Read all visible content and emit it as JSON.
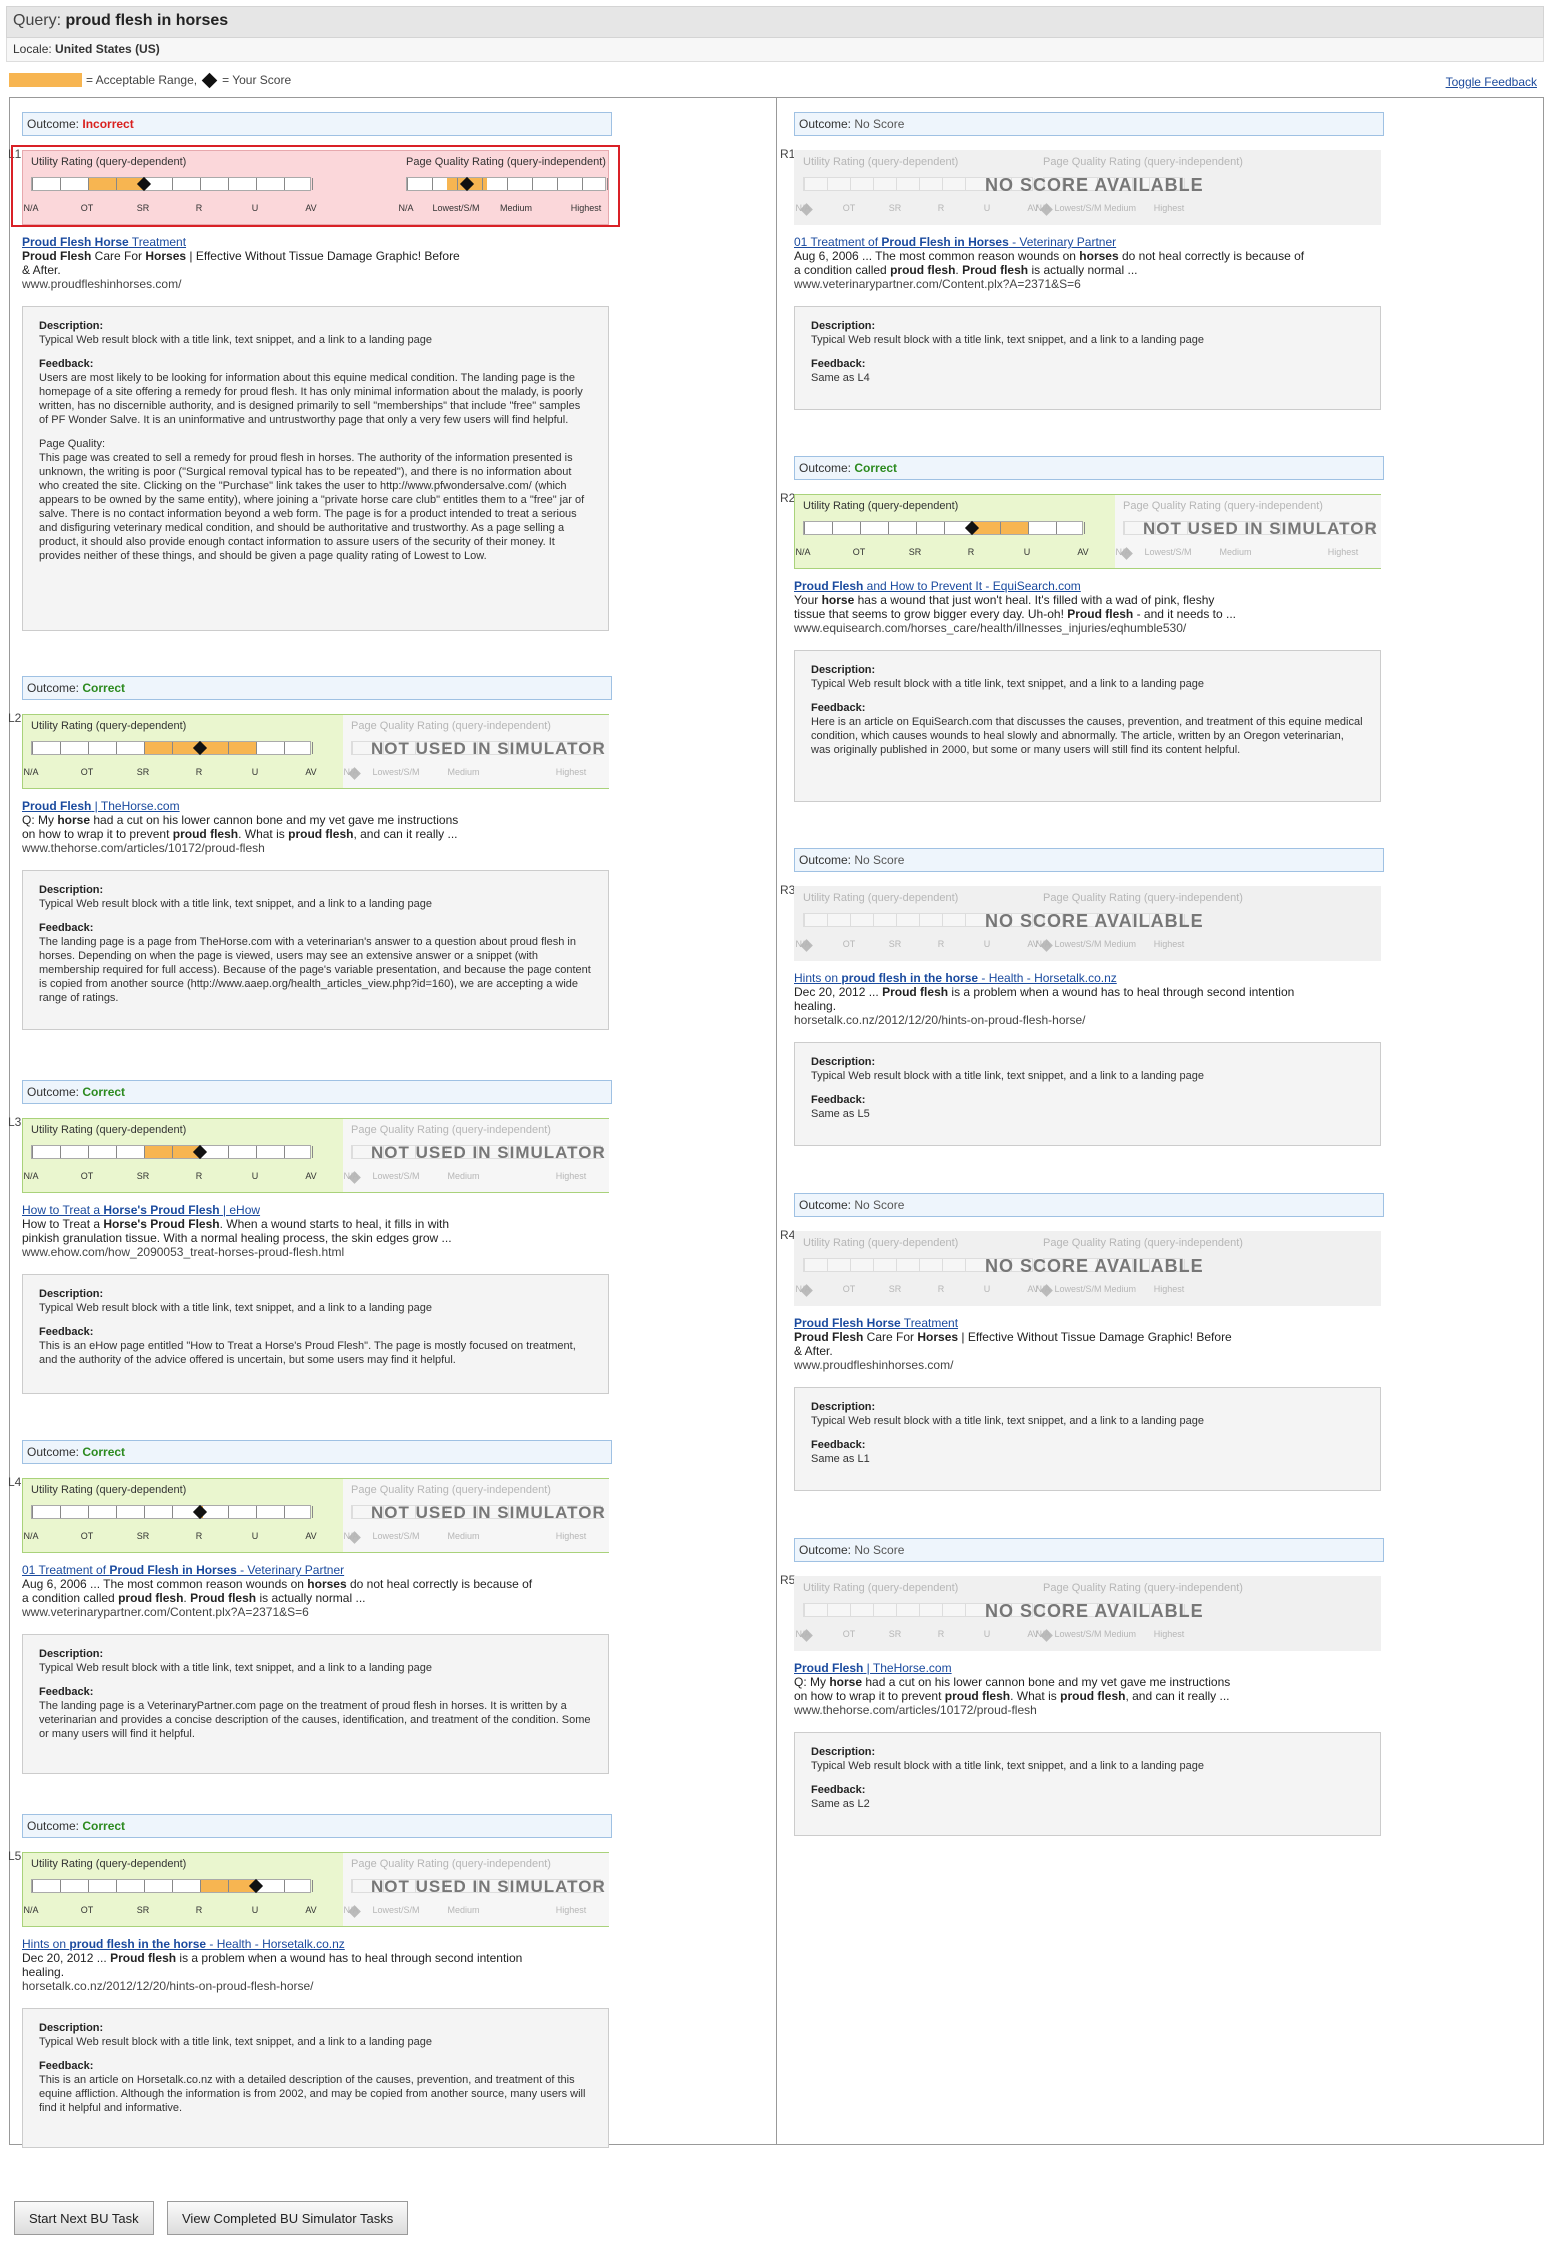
{
  "query": {
    "label": "Query:",
    "value": "proud flesh in horses"
  },
  "locale": {
    "label": "Locale:",
    "value": "United States (US)"
  },
  "legend": {
    "range_text": "= Acceptable Range,",
    "score_text": "= Your Score"
  },
  "toggle_feedback": "Toggle Feedback",
  "labels": {
    "outcome": "Outcome:",
    "utility": "Utility Rating (query-dependent)",
    "pq": "Page Quality Rating (query-independent)",
    "description": "Description:",
    "feedback": "Feedback:",
    "no_score": "NO SCORE AVAILABLE",
    "not_used": "NOT USED IN SIMULATOR"
  },
  "utility_scale": [
    "N/A",
    "OT",
    "SR",
    "R",
    "U",
    "AV"
  ],
  "pq_scale": [
    "N/A",
    "Lowest/S/M",
    "Medium",
    "Highest"
  ],
  "description_text": "Typical Web result block with a title link, text snippet, and a link to a landing page",
  "left": [
    {
      "id": "L1.",
      "outcome": "Incorrect",
      "title_a": "Proud Flesh Horse",
      "title_b": " Treatment",
      "snip_b1": "Proud Flesh",
      "snip_1": " Care For ",
      "snip_b2": "Horses",
      "snip_2": " | Effective Without Tissue Damage Graphic! Before",
      "snip_3": "& After.",
      "url": "www.proudfleshinhorses.com/",
      "feedback": "Users are most likely to be looking for information about this equine medical condition. The landing page is the homepage of a site offering a remedy for proud flesh. It has only minimal information about the malady, is poorly written, has no discernible authority, and is designed primarily to sell \"memberships\" that include \"free\" samples of PF Wonder Salve. It is an uninformative and untrustworthy page that only a very few users will find helpful.",
      "pq_heading": "Page Quality:",
      "pq_text": "This page was created to sell a remedy for proud flesh in horses. The authority of the information presented is unknown, the writing is poor (\"Surgical removal typical has to be repeated\"), and there is no information about who created the site. Clicking on the \"Purchase\" link takes the user to http://www.pfwondersalve.com/ (which appears to be owned by the same entity), where joining a \"private horse care club\" entitles them to a \"free\" jar of salve. There is no contact information beyond a web form. The page is for a product intended to treat a serious and disfiguring veterinary medical condition, and should be authoritative and trustworthy. As a page selling a product, it should also provide enough contact information to assure users of the security of their money. It provides neither of these things, and should be given a page quality rating of Lowest to Low."
    },
    {
      "id": "L2.",
      "outcome": "Correct",
      "title_a": "Proud Flesh",
      "title_b": " | TheHorse.com",
      "snip_1": "Q: My ",
      "snip_b1": "horse",
      "snip_2": " had a cut on his lower cannon bone and my vet gave me instructions",
      "snip_3": "on how to wrap it to prevent ",
      "snip_b2": "proud flesh",
      "snip_4": ". What is ",
      "snip_b3": "proud flesh",
      "snip_5": ", and can it really ...",
      "url": "www.thehorse.com/articles/10172/proud-flesh",
      "feedback": "The landing page is a page from TheHorse.com with a veterinarian's answer to a question about proud flesh in horses. Depending on when the page is viewed, users may see an extensive answer or a snippet (with membership required for full access). Because of the page's variable presentation, and because the page content is copied from another source (http://www.aaep.org/health_articles_view.php?id=160), we are accepting a wide range of ratings."
    },
    {
      "id": "L3.",
      "outcome": "Correct",
      "title_a": "How to Treat a ",
      "title_b": "Horse's Proud Flesh",
      "title_c": " | eHow",
      "snip_1": "How to Treat a ",
      "snip_b1": "Horse's Proud Flesh",
      "snip_2": ". When a wound starts to heal, it fills in with",
      "snip_3": "pinkish granulation tissue. With a normal healing process, the skin edges grow ...",
      "url": "www.ehow.com/how_2090053_treat-horses-proud-flesh.html",
      "feedback": "This is an eHow page entitled \"How to Treat a Horse's Proud Flesh\". The page is mostly focused on treatment, and the authority of the advice offered is uncertain, but some users may find it helpful."
    },
    {
      "id": "L4.",
      "outcome": "Correct",
      "title_a": "01 Treatment of ",
      "title_b": "Proud Flesh in Horses",
      "title_c": " - Veterinary Partner",
      "snip_1": "Aug 6, 2006 ... The most common reason wounds on ",
      "snip_b1": "horses",
      "snip_2": " do not heal correctly is because of",
      "snip_3": "a condition called ",
      "snip_b2": "proud flesh",
      "snip_4": ". ",
      "snip_b3": "Proud flesh",
      "snip_5": " is actually normal ...",
      "url": "www.veterinarypartner.com/Content.plx?A=2371&S=6",
      "feedback": "The landing page is a VeterinaryPartner.com page on the treatment of proud flesh in horses. It is written by a veterinarian and provides a concise description of the causes, identification, and treatment of the condition. Some or many users will find it helpful."
    },
    {
      "id": "L5.",
      "outcome": "Correct",
      "title_a": "Hints on ",
      "title_b": "proud flesh in the horse",
      "title_c": " - Health - Horsetalk.co.nz",
      "snip_1": "Dec 20, 2012 ... ",
      "snip_b1": "Proud flesh",
      "snip_2": " is a problem when a wound has to heal through second intention",
      "snip_3": "healing.",
      "url": "horsetalk.co.nz/2012/12/20/hints-on-proud-flesh-horse/",
      "feedback": "This is an article on Horsetalk.co.nz with a detailed description of the causes, prevention, and treatment of this equine affliction. Although the information is from 2002, and may be copied from another source, many users will find it helpful and informative."
    }
  ],
  "right": [
    {
      "id": "R1.",
      "outcome": "No Score",
      "title_a": "01 Treatment of ",
      "title_b": "Proud Flesh in Horses",
      "title_c": " - Veterinary Partner",
      "snip_1": "Aug 6, 2006 ... The most common reason wounds on ",
      "snip_b1": "horses",
      "snip_2": " do not heal correctly is because of",
      "snip_3": "a condition called ",
      "snip_b2": "proud flesh",
      "snip_4": ". ",
      "snip_b3": "Proud flesh",
      "snip_5": " is actually normal ...",
      "url": "www.veterinarypartner.com/Content.plx?A=2371&S=6",
      "feedback": "Same as L4"
    },
    {
      "id": "R2.",
      "outcome": "Correct",
      "title_a": "Proud Flesh",
      "title_b": " and How to Prevent It - EquiSearch.com",
      "snip_1": "Your ",
      "snip_b1": "horse",
      "snip_2": " has a wound that just won't heal. It's filled with a wad of pink, fleshy",
      "snip_3": "tissue that seems to grow bigger every day. Uh-oh! ",
      "snip_b2": "Proud flesh",
      "snip_4": " - and it needs to ...",
      "url": "www.equisearch.com/horses_care/health/illnesses_injuries/eqhumble530/",
      "feedback": "Here is an article on EquiSearch.com that discusses the causes, prevention, and treatment of this equine medical condition, which causes wounds to heal slowly and abnormally. The article, written by an Oregon veterinarian, was originally published in 2000, but some or many users will still find its content helpful."
    },
    {
      "id": "R3.",
      "outcome": "No Score",
      "title_a": "Hints on ",
      "title_b": "proud flesh in the horse",
      "title_c": " - Health - Horsetalk.co.nz",
      "snip_1": "Dec 20, 2012 ... ",
      "snip_b1": "Proud flesh",
      "snip_2": " is a problem when a wound has to heal through second intention",
      "snip_3": "healing.",
      "url": "horsetalk.co.nz/2012/12/20/hints-on-proud-flesh-horse/",
      "feedback": "Same as L5"
    },
    {
      "id": "R4.",
      "outcome": "No Score",
      "title_a": "Proud Flesh Horse",
      "title_b": " Treatment",
      "snip_b1": "Proud Flesh",
      "snip_1": " Care For ",
      "snip_b2": "Horses",
      "snip_2": " | Effective Without Tissue Damage Graphic! Before",
      "snip_3": "& After.",
      "url": "www.proudfleshinhorses.com/",
      "feedback": "Same as L1"
    },
    {
      "id": "R5.",
      "outcome": "No Score",
      "title_a": "Proud Flesh",
      "title_b": " | TheHorse.com",
      "snip_1": "Q: My ",
      "snip_b1": "horse",
      "snip_2": " had a cut on his lower cannon bone and my vet gave me instructions",
      "snip_3": "on how to wrap it to prevent ",
      "snip_b2": "proud flesh",
      "snip_4": ". What is ",
      "snip_b3": "proud flesh",
      "snip_5": ", and can it really ...",
      "url": "www.thehorse.com/articles/10172/proud-flesh",
      "feedback": "Same as L2"
    }
  ],
  "ratings": {
    "L1": {
      "utility_range": [
        0.2,
        0.4
      ],
      "utility_score": 0.4,
      "pq_range": [
        0.2,
        0.4
      ],
      "pq_score": 0.3
    },
    "L2": {
      "utility_range": [
        0.4,
        0.8
      ],
      "utility_score": 0.6
    },
    "L3": {
      "utility_range": [
        0.4,
        0.6
      ],
      "utility_score": 0.6
    },
    "L4": {
      "utility_range": [
        0.6,
        0.6
      ],
      "utility_score": 0.6
    },
    "L5": {
      "utility_range": [
        0.6,
        0.8
      ],
      "utility_score": 0.8
    },
    "R2": {
      "utility_range": [
        0.6,
        0.8
      ],
      "utility_score": 0.6
    }
  },
  "buttons": {
    "start_next": "Start Next BU Task",
    "view_completed": "View Completed BU Simulator Tasks"
  }
}
